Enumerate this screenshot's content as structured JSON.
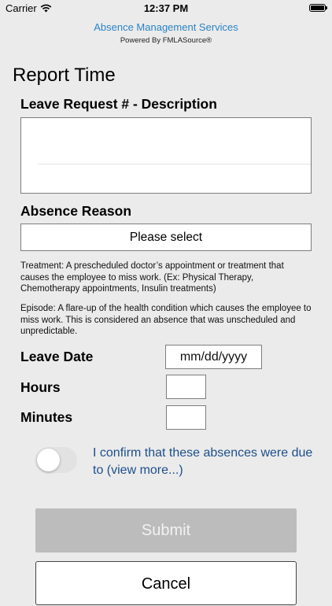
{
  "status_bar": {
    "carrier": "Carrier",
    "time": "12:37 PM",
    "icons": [
      "wifi-icon",
      "battery-icon"
    ]
  },
  "app_header": {
    "title": "Absence Management Services",
    "subtitle": "Powered By FMLASource®"
  },
  "page": {
    "title": "Report Time"
  },
  "leave_request": {
    "label": "Leave Request # - Description",
    "value": ""
  },
  "absence_reason": {
    "label": "Absence Reason",
    "selected": "Please select"
  },
  "info": {
    "treatment": "Treatment: A prescheduled doctor’s appointment or treatment that causes the employee to miss work. (Ex: Physical Therapy, Chemotherapy appointments, Insulin treatments)",
    "episode": "Episode: A flare-up of the health condition which causes the employee to miss work. This is considered an absence that was unscheduled and unpredictable."
  },
  "leave_date": {
    "label": "Leave Date",
    "placeholder": "mm/dd/yyyy"
  },
  "hours": {
    "label": "Hours",
    "value": ""
  },
  "minutes": {
    "label": "Minutes",
    "value": ""
  },
  "confirm": {
    "toggle_on": false,
    "text": "I confirm that these absences were due to (view more...)"
  },
  "buttons": {
    "submit": "Submit",
    "cancel": "Cancel"
  },
  "colors": {
    "header_title": "#2a84c4",
    "confirm_text": "#1c4f8c",
    "submit_disabled": "#bcbcbc",
    "background": "#ebebeb"
  }
}
